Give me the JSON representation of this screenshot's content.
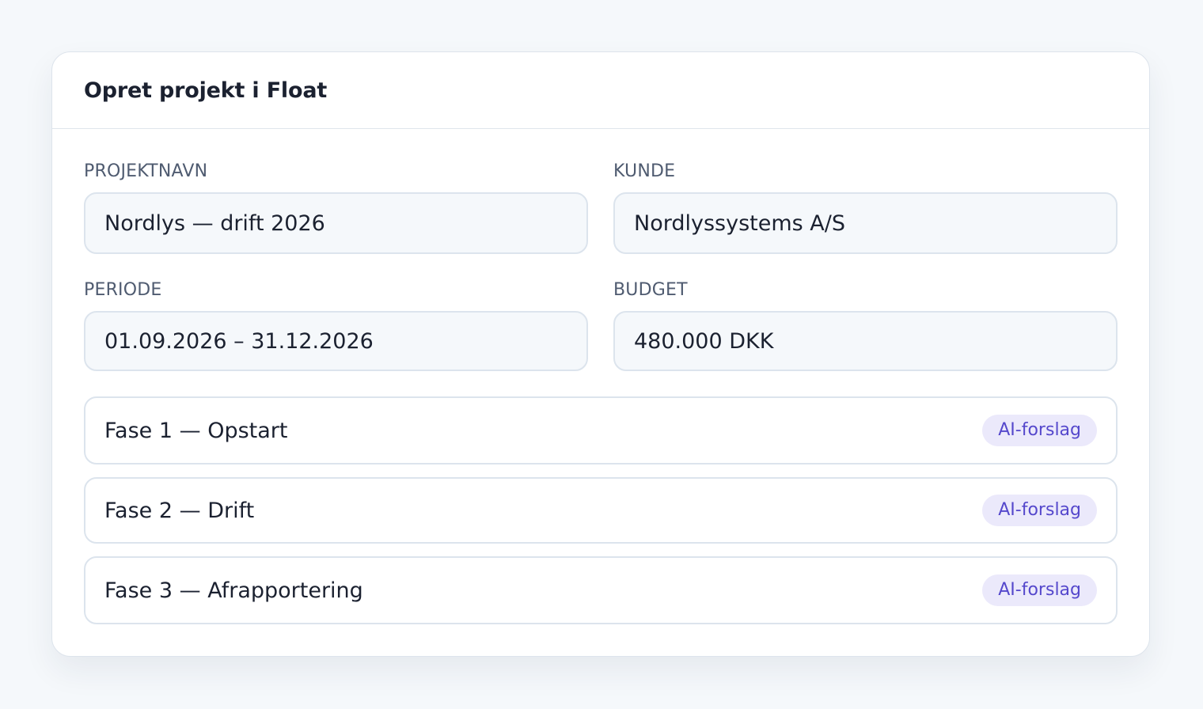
{
  "card": {
    "title": "Opret projekt i Float"
  },
  "fields": {
    "project_name": {
      "label": "PROJEKTNAVN",
      "value": "Nordlys — drift 2026"
    },
    "customer": {
      "label": "KUNDE",
      "value": "Nordlyssystems A/S"
    },
    "period": {
      "label": "PERIODE",
      "value": "01.09.2026 – 31.12.2026"
    },
    "budget": {
      "label": "BUDGET",
      "value": "480.000 DKK"
    }
  },
  "phases": [
    {
      "name": "Fase 1 — Opstart",
      "badge": "AI-forslag"
    },
    {
      "name": "Fase 2 — Drift",
      "badge": "AI-forslag"
    },
    {
      "name": "Fase 3 — Afrapportering",
      "badge": "AI-forslag"
    }
  ],
  "colors": {
    "background": "#f5f8fb",
    "card": "#ffffff",
    "border": "#dce4ed",
    "label": "#4f5b70",
    "text": "#1b2130",
    "badge_bg": "#ebe9fb",
    "badge_text": "#5548cc"
  }
}
